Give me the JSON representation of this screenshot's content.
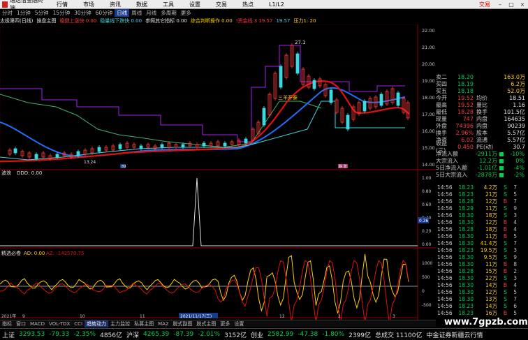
{
  "menu": {
    "app_title": "通达信金融终端",
    "items": [
      "行情",
      "市场",
      "资讯",
      "数据",
      "工具",
      "设置",
      "交易",
      "热点",
      "L1/L2"
    ],
    "trade_label": "交易"
  },
  "periods": [
    "分时",
    "1分钟",
    "5分钟",
    "15分钟",
    "30分钟",
    "60分钟",
    "日线",
    "周线",
    "月线",
    "多周期",
    "更多"
  ],
  "active_period": "日线",
  "infobar": [
    {
      "text": "太极第四(日线)",
      "color": "#e0e0e0"
    },
    {
      "text": "操盘主图",
      "color": "#e0e0e0"
    },
    {
      "text": "稳健上涨快 0.00",
      "color": "#ff3b3b"
    },
    {
      "text": "稳量线下跌快 0.00",
      "color": "#3fd8e0"
    },
    {
      "text": "参照其它指标 0.00",
      "color": "#e0e0e0"
    },
    {
      "text": "综合判断操作 0.00",
      "color": "#ffd000"
    },
    {
      "text": "!资金线 3 19.57",
      "color": "#ff3b3b"
    },
    {
      "text": "19.57",
      "color": "#3fd8e0"
    },
    {
      "text": "压力1: 20",
      "color": "#ffd000"
    }
  ],
  "price_axis": [
    "22.00",
    "21.00",
    "20.00",
    "19.00",
    "18.00",
    "17.00",
    "16.00",
    "15.00",
    "14.00"
  ],
  "chart_labels": {
    "high": "27.1",
    "sanliangang": "三羊开泰",
    "low_marker": "13.24",
    "bars_label1": "89",
    "bars_label2": "跌 涨"
  },
  "sub1": {
    "title": "波浪",
    "value": "DDD: 0.00"
  },
  "sub2": {
    "title": "精选必卷",
    "ad": "AD: 0.00",
    "ad2": "AZ: -142570.75"
  },
  "sub_axis1": [
    "1.00",
    "0.80",
    "0.60",
    "0.40",
    "0.20",
    "0.00"
  ],
  "sub_axis2": [
    "1000",
    "500",
    "0",
    "-500"
  ],
  "mid_marker": "0.36",
  "date_axis": {
    "left": "2021年",
    "highlight": "2021/11/17(三)",
    "marks": [
      "9",
      "10",
      "11",
      "12",
      "2",
      "3"
    ]
  },
  "quote": {
    "rows": [
      [
        "卖二",
        "18.20",
        "",
        "163.0万"
      ],
      [
        "买四",
        "18.19",
        "",
        "6.2万"
      ],
      [
        "买五",
        "18.18",
        "",
        "52.0万"
      ],
      [
        "今开",
        "19.52",
        "均价",
        "18.51"
      ],
      [
        "最高",
        "19.52",
        "量比",
        "1.16"
      ],
      [
        "最低",
        "18.28",
        "换手",
        "101.5亿"
      ],
      [
        "现量",
        "747",
        "内盘",
        "164635"
      ],
      [
        "外盘",
        "74396",
        "内盘",
        "90239"
      ],
      [
        "换手",
        "2.96%",
        "股本",
        "5.57亿"
      ],
      [
        "净资",
        "6.02",
        "流通",
        "5.57亿"
      ],
      [
        "收益(三)",
        "0.450",
        "PE(动)",
        "30.7"
      ]
    ],
    "flows": [
      {
        "k": "净流入额",
        "v": "-2911万",
        "pct": "-10%"
      },
      {
        "k": "大宗流入",
        "v": "12.2万",
        "pct": "0%"
      },
      {
        "k": "5日净流入额",
        "v": "-1.01亿",
        "pct": "-4%"
      },
      {
        "k": "5日大宗流入",
        "v": "-2878万",
        "pct": "-2%"
      }
    ]
  },
  "ticks": [
    [
      "14:56",
      "18.23",
      "4.2万",
      "S",
      "7"
    ],
    [
      "14:56",
      "18.23",
      "21万",
      "S",
      "5"
    ],
    [
      "14:56",
      "18.28",
      "12万",
      "B",
      "7"
    ],
    [
      "14:56",
      "18.29",
      "11万",
      "S",
      "9"
    ],
    [
      "14:56",
      "18.30",
      "18万",
      "S",
      "3"
    ],
    [
      "14:56",
      "18.30",
      "12万",
      "B",
      "4"
    ],
    [
      "14:56",
      "18.28",
      "18万",
      "B",
      "4"
    ],
    [
      "14:56",
      "18.30",
      "11万",
      "B",
      "5"
    ],
    [
      "14:56",
      "18.30",
      "41.4万",
      "S",
      "7"
    ],
    [
      "14:56",
      "18.23",
      "19.5万",
      "S",
      "3"
    ],
    [
      "14:56",
      "18.30",
      "9.5万",
      "S",
      "9"
    ],
    [
      "14:56",
      "18.30",
      "11万",
      "B",
      "8"
    ],
    [
      "14:56",
      "18.28",
      "15万",
      "B",
      "2"
    ],
    [
      "14:56",
      "18.30",
      "22万",
      "S",
      "3"
    ],
    [
      "14:56",
      "18.30",
      "14万",
      "B",
      "4"
    ],
    [
      "14:56",
      "18.30",
      "12万",
      "S",
      "5"
    ],
    [
      "14:56",
      "18.30",
      "13万",
      "S",
      "7"
    ],
    [
      "14:56",
      "18.23",
      "14万",
      "S",
      "6"
    ],
    [
      "14:56",
      "18.23",
      "16万",
      "B",
      "5"
    ]
  ],
  "tabs": [
    "指标",
    "窗口",
    "MACD",
    "VOL-TDX",
    "CCI",
    "趋势动力",
    "主力监控",
    "私募主图",
    "MA2",
    "脱式副图",
    "脱式主图",
    "更多",
    "设置"
  ],
  "tabs2": [
    "选择",
    "关联报价",
    "资金分布",
    "综合资讯",
    "行业资讯",
    "互动问答",
    "新用户福利专享"
  ],
  "active_tab": "趋势动力",
  "status": [
    {
      "label": "上证",
      "value": "3293.53",
      "chg": "-79.33",
      "pct": "-2.35%",
      "amt": "4856亿"
    },
    {
      "label": "沪深",
      "value": "4265.39",
      "chg": "-87.39",
      "pct": "-2.01%",
      "amt": "3152亿"
    },
    {
      "label": "创业",
      "value": "2582.99",
      "chg": "-47.38",
      "pct": "-1.80%",
      "amt": "2399亿"
    }
  ],
  "status_extra": "总成交  11100亿",
  "status_news": "中金证券新疆云行情",
  "watermark": "www.7gpzb.com"
}
